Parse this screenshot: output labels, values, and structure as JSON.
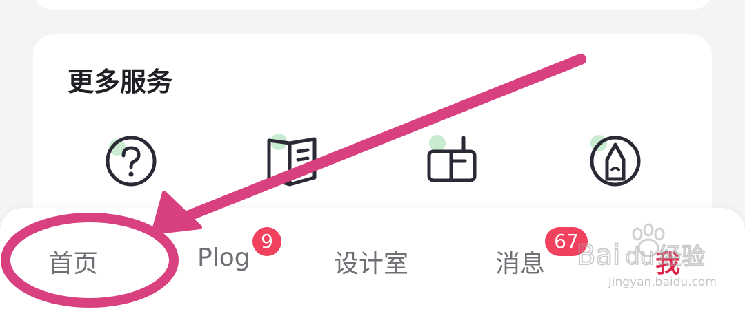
{
  "services_title": "更多服务",
  "services": [
    {
      "icon": "help-question-icon"
    },
    {
      "icon": "book-guide-icon"
    },
    {
      "icon": "mailbox-icon"
    },
    {
      "icon": "pen-tip-icon"
    }
  ],
  "tabs": [
    {
      "label": "首页",
      "badge": ""
    },
    {
      "label": "Plog",
      "badge": "9"
    },
    {
      "label": "设计室",
      "badge": ""
    },
    {
      "label": "消息",
      "badge": "67"
    },
    {
      "label": "我",
      "badge": ""
    }
  ],
  "watermark": {
    "brand": "Baidu 经验",
    "url": "jingyan.baidu.com"
  },
  "colors": {
    "accent": "#e0264d",
    "badge": "#f0415f",
    "annotation": "#d9407f",
    "icon_dot": "#c9ecd0"
  }
}
